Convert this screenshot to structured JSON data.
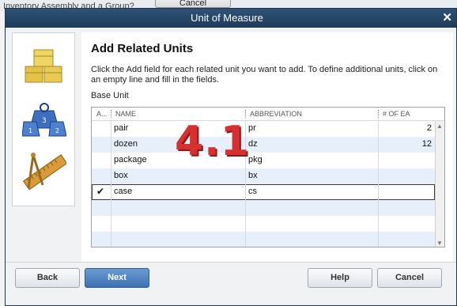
{
  "background": {
    "top_text": "Inventory Assembly and a Group?",
    "cancel_label": "Cancel"
  },
  "dialog": {
    "title": "Unit of Measure",
    "heading": "Add Related Units",
    "instructions": "Click the Add field for each related unit you want to add. To define additional units, click on an empty line and fill in the fields.",
    "base_unit_label": "Base Unit"
  },
  "grid": {
    "columns": [
      "A...",
      "NAME",
      "ABBREVIATION",
      "# OF EA"
    ],
    "rows": [
      {
        "add": "",
        "name": "pair",
        "abbreviation": "pr",
        "count": "2"
      },
      {
        "add": "",
        "name": "dozen",
        "abbreviation": "dz",
        "count": "12"
      },
      {
        "add": "",
        "name": "package",
        "abbreviation": "pkg",
        "count": ""
      },
      {
        "add": "",
        "name": "box",
        "abbreviation": "bx",
        "count": ""
      },
      {
        "add": "✔",
        "name": "case",
        "abbreviation": "cs",
        "count": ""
      }
    ]
  },
  "overlay": {
    "step": "4.1"
  },
  "buttons": {
    "back": "Back",
    "next": "Next",
    "help": "Help",
    "cancel": "Cancel"
  },
  "icons": [
    "boxes-icon",
    "weights-icon",
    "ruler-compass-icon"
  ]
}
